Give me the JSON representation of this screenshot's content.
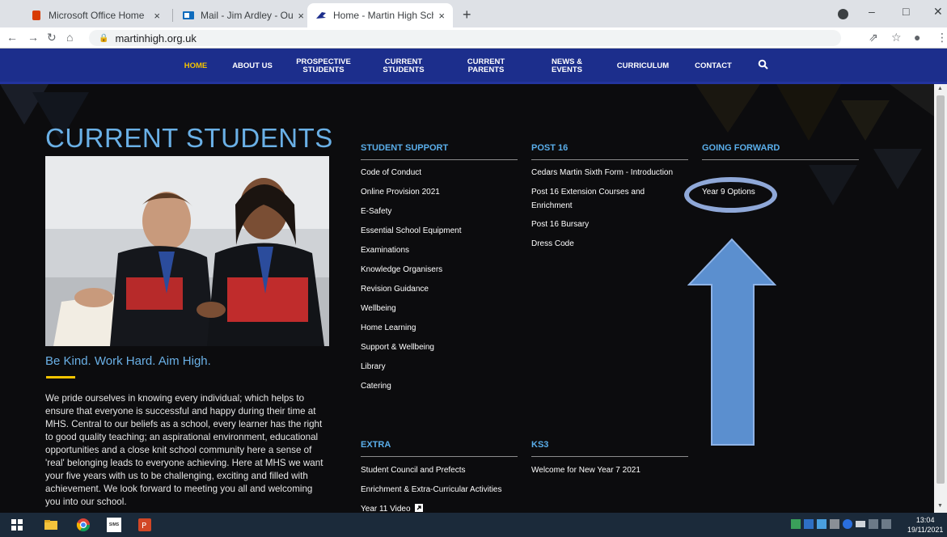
{
  "browser": {
    "tabs": [
      {
        "title": "Microsoft Office Home",
        "close": "×"
      },
      {
        "title": "Mail - Jim Ardley - Outlook",
        "close": "×"
      },
      {
        "title": "Home - Martin High School | Lio",
        "close": "×"
      }
    ],
    "new_tab": "+",
    "address": "martinhigh.org.uk",
    "window_controls": {
      "minimize": "–",
      "maximize": "□",
      "close": "✕"
    }
  },
  "nav": {
    "items": [
      {
        "label": "HOME"
      },
      {
        "label": "ABOUT US"
      },
      {
        "label": "PROSPECTIVE STUDENTS"
      },
      {
        "label": "CURRENT STUDENTS"
      },
      {
        "label": "CURRENT PARENTS"
      },
      {
        "label": "NEWS & EVENTS"
      },
      {
        "label": "CURRICULUM"
      },
      {
        "label": "CONTACT"
      }
    ]
  },
  "page": {
    "title": "CURRENT STUDENTS",
    "motto": "Be Kind. Work Hard. Aim High.",
    "intro": "We pride ourselves in knowing every individual; which helps to ensure that everyone is successful and happy during their time at MHS. Central to our beliefs as a school, every learner has the right to good quality teaching; an aspirational environment, educational opportunities and a close knit school community here a sense of 'real' belonging leads to everyone achieving. Here at MHS we want your five years with us to be challenging, exciting and filled with achievement. We look forward to meeting you all and welcoming you into our school."
  },
  "columns": {
    "student_support": {
      "heading": "STUDENT SUPPORT",
      "links": [
        "Code of Conduct",
        "Online Provision 2021",
        "E-Safety",
        "Essential School Equipment",
        "Examinations",
        "Knowledge Organisers",
        "Revision Guidance",
        "Wellbeing",
        "Home Learning",
        "Support & Wellbeing",
        "Library",
        "Catering"
      ]
    },
    "post16": {
      "heading": "POST 16",
      "links": [
        "Cedars Martin Sixth Form - Introduction",
        "Post 16 Extension Courses and Enrichment",
        "Post 16 Bursary",
        "Dress Code"
      ]
    },
    "going_forward": {
      "heading": "GOING FORWARD",
      "links": [
        "Year 9 Options"
      ]
    },
    "extra": {
      "heading": "EXTRA",
      "links": [
        "Student Council and Prefects",
        "Enrichment & Extra-Curricular Activities",
        "Year 11 Video"
      ]
    },
    "ks3": {
      "heading": "KS3",
      "links": [
        "Welcome for New Year 7 2021"
      ]
    }
  },
  "taskbar": {
    "time": "13:04",
    "date": "19/11/2021",
    "sims_label": "SIMS"
  },
  "colors": {
    "nav_bg": "#1c2e8c",
    "accent_yellow": "#f4c400",
    "heading_blue": "#5aaeea",
    "annotation_blue": "#8fa8d8",
    "arrow_blue": "#5b8fcf"
  }
}
